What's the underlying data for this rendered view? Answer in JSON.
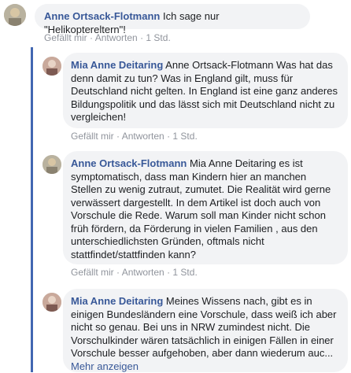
{
  "actions": {
    "like": "Gefällt mir",
    "reply": "Antworten",
    "sep": "·"
  },
  "comments": [
    {
      "author": "Anne Ortsack-Flotmann",
      "text": "Ich sage nur \"Helikoptereltern\"!",
      "time": "1 Std."
    },
    {
      "author": "Mia Anne Deitaring",
      "text": "Anne Ortsack-Flotmann Was hat das denn damit zu tun? Was in England gilt, muss für Deutschland nicht gelten. In England ist eine ganz anderes Bildungspolitik und das lässt sich mit Deutschland nicht zu vergleichen!",
      "time": "1 Std."
    },
    {
      "author": "Anne Ortsack-Flotmann",
      "text": "Mia Anne Deitaring es ist symptomatisch, dass man Kindern hier an manchen Stellen zu wenig zutraut, zumutet. Die Realität wird gerne verwässert dargestellt. In dem Artikel ist doch auch von Vorschule die Rede. Warum soll man Kinder nicht schon früh fördern, da Förderung in vielen Familien , aus den unterschiedlichsten Gründen, oftmals nicht stattfindet/stattfinden kann?",
      "time": "1 Std."
    },
    {
      "author": "Mia Anne Deitaring",
      "text": "Meines Wissens nach, gibt es in einigen Bundesländern eine Vorschule, dass weiß ich aber nicht so genau. Bei uns in NRW zumindest nicht. Die Vorschulkinder wären tatsächlich in einigen Fällen in einer Vorschule besser aufgehoben, aber dann wiederum auc...",
      "more": "Mehr anzeigen"
    }
  ]
}
